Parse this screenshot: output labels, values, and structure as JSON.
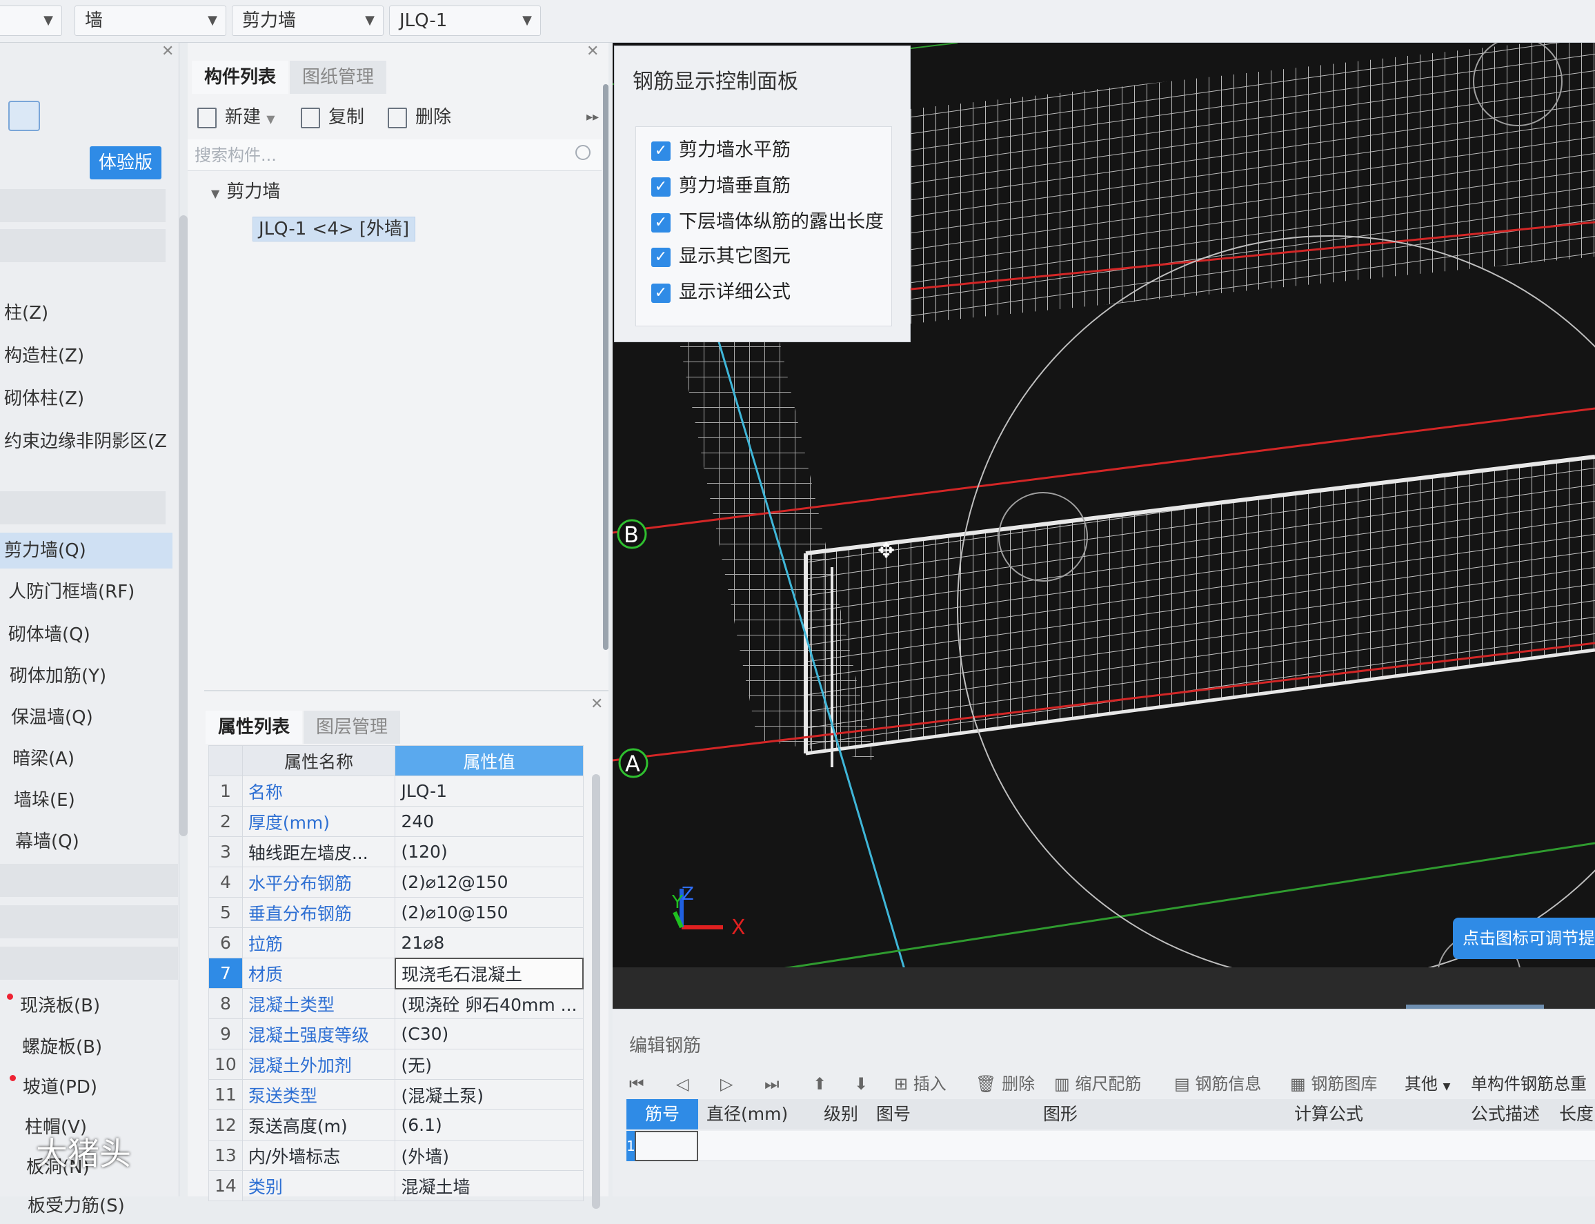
{
  "topbar": {
    "selects": [
      "",
      "墙",
      "剪力墙",
      "JLQ-1"
    ]
  },
  "leftnav": {
    "badge": "体验版",
    "items": [
      "柱(Z)",
      "构造柱(Z)",
      "砌体柱(Z)",
      "约束边缘非阴影区(Z",
      "剪力墙(Q)",
      "人防门框墙(RF)",
      "砌体墙(Q)",
      "砌体加筋(Y)",
      "保温墙(Q)",
      "暗梁(A)",
      "墙垛(E)",
      "幕墙(Q)"
    ],
    "items2": [
      "现浇板(B)",
      "螺旋板(B)",
      "坡道(PD)",
      "柱帽(V)",
      "板洞(N)",
      "板受力筋(S)"
    ]
  },
  "components": {
    "tabs": [
      "构件列表",
      "图纸管理"
    ],
    "toolbar": {
      "new": "新建",
      "copy": "复制",
      "delete": "删除"
    },
    "search_placeholder": "搜索构件...",
    "tree_group": "剪力墙",
    "tree_item": "JLQ-1 <4> [外墙]"
  },
  "properties": {
    "tabs": [
      "属性列表",
      "图层管理"
    ],
    "col_name": "属性名称",
    "col_value": "属性值",
    "rows": [
      {
        "n": "1",
        "name": "名称",
        "value": "JLQ-1",
        "blue": true
      },
      {
        "n": "2",
        "name": "厚度(mm)",
        "value": "240",
        "blue": true
      },
      {
        "n": "3",
        "name": "轴线距左墙皮...",
        "value": "(120)",
        "blue": false
      },
      {
        "n": "4",
        "name": "水平分布钢筋",
        "value": "(2)⌀12@150",
        "blue": true
      },
      {
        "n": "5",
        "name": "垂直分布钢筋",
        "value": "(2)⌀10@150",
        "blue": true
      },
      {
        "n": "6",
        "name": "拉筋",
        "value": "21⌀8",
        "blue": true
      },
      {
        "n": "7",
        "name": "材质",
        "value": "现浇毛石混凝土",
        "blue": true
      },
      {
        "n": "8",
        "name": "混凝土类型",
        "value": "(现浇砼 卵石40mm ...",
        "blue": true
      },
      {
        "n": "9",
        "name": "混凝土强度等级",
        "value": "(C30)",
        "blue": true
      },
      {
        "n": "10",
        "name": "混凝土外加剂",
        "value": "(无)",
        "blue": true
      },
      {
        "n": "11",
        "name": "泵送类型",
        "value": "(混凝土泵)",
        "blue": true
      },
      {
        "n": "12",
        "name": "泵送高度(m)",
        "value": "(6.1)",
        "blue": false
      },
      {
        "n": "13",
        "name": "内/外墙标志",
        "value": "(外墙)",
        "blue": false
      },
      {
        "n": "14",
        "name": "类别",
        "value": "混凝土墙",
        "blue": true
      }
    ]
  },
  "control_panel": {
    "title": "钢筋显示控制面板",
    "options": [
      "剪力墙水平筋",
      "剪力墙垂直筋",
      "下层墙体纵筋的露出长度",
      "显示其它图元",
      "显示详细公式"
    ]
  },
  "viewport": {
    "axis_b": "B",
    "axis_a": "A",
    "axis_x": "X",
    "axis_y": "Y",
    "axis_z": "Z",
    "tip": "点击图标可调节提"
  },
  "rebar_editor": {
    "title": "编辑钢筋",
    "tools": [
      "插入",
      "删除",
      "缩尺配筋",
      "钢筋信息",
      "钢筋图库",
      "其他",
      "单构件钢筋总重"
    ],
    "columns": [
      "筋号",
      "直径(mm)",
      "级别",
      "图号",
      "图形",
      "计算公式",
      "公式描述",
      "长度"
    ],
    "row1": "1"
  },
  "watermark": "大猪头"
}
